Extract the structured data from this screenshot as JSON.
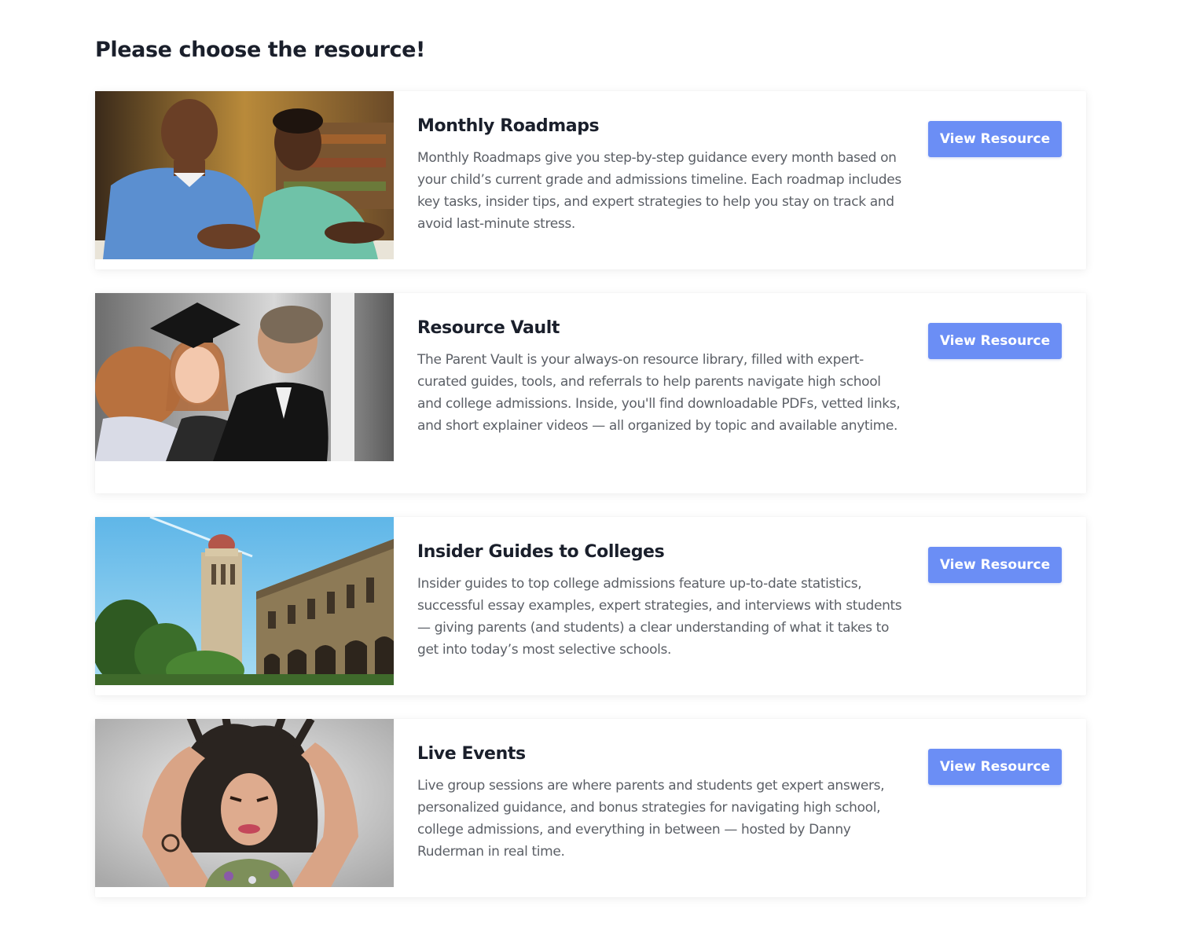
{
  "page": {
    "title": "Please choose the resource!"
  },
  "accent_color": "#6b8ef5",
  "resources": [
    {
      "title": "Monthly Roadmaps",
      "description": "Monthly Roadmaps give you step-by-step guidance every month based on your child’s current grade and admissions timeline. Each roadmap includes key tasks, insider tips, and expert strategies to help you stay on track and avoid last-minute stress.",
      "button_label": "View Resource",
      "image": "photo-parent-and-teen-studying"
    },
    {
      "title": "Resource Vault",
      "description": "The Parent Vault is your always-on resource library, filled with expert-curated guides, tools, and referrals to help parents navigate high school and college admissions. Inside, you'll find downloadable PDFs, vetted links, and short explainer videos — all organized by topic and available anytime.",
      "button_label": "View Resource",
      "image": "photo-graduate-hugging-family"
    },
    {
      "title": "Insider Guides to Colleges",
      "description": "Insider guides to top college admissions feature up-to-date statistics, successful essay examples, expert strategies, and interviews with students — giving parents (and students) a clear understanding of what it takes to get into today’s most selective schools.",
      "button_label": "View Resource",
      "image": "photo-university-campus-tower"
    },
    {
      "title": "Live Events",
      "description": "Live group sessions are where parents and students get expert answers, personalized guidance, and bonus strategies for navigating high school, college admissions, and everything in between — hosted by Danny Ruderman in real time.",
      "button_label": "View Resource",
      "image": "photo-frustrated-student"
    }
  ]
}
